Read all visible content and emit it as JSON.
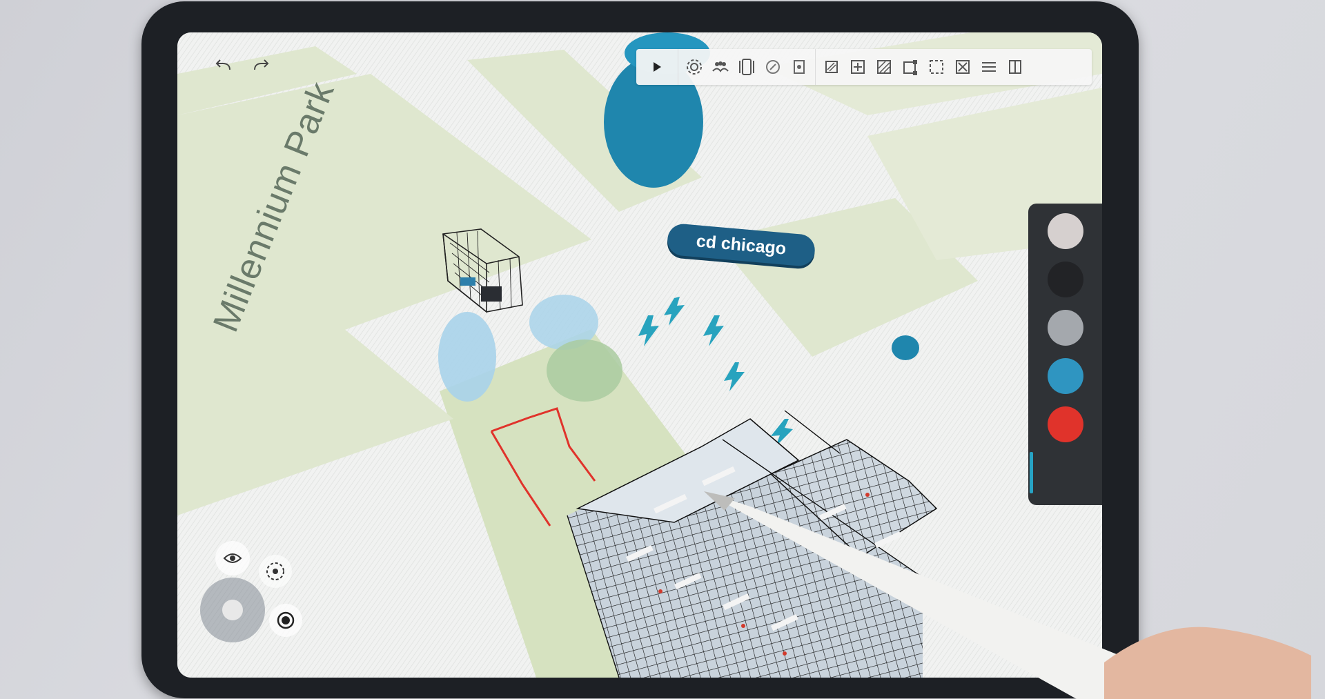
{
  "map": {
    "park_label": "Millennium Park",
    "location_tag": "cd chicago"
  },
  "history": {
    "undo_icon": "undo-arrow-icon",
    "redo_icon": "redo-arrow-icon"
  },
  "toolbar": {
    "groups": [
      [
        "play-icon"
      ],
      [
        "gear-icon",
        "people-icon",
        "phone-frame-icon",
        "compass-icon",
        "layers-target-icon"
      ],
      [
        "hatch-small-icon",
        "add-box-icon",
        "hatch-box-icon",
        "corner-handle-icon",
        "dashed-select-icon",
        "cross-box-icon",
        "split-horizontal-icon",
        "split-vertical-icon"
      ]
    ]
  },
  "palette": {
    "colors": [
      "#d6d0cf",
      "#222326",
      "#a4a8ad",
      "#2f95c1",
      "#e0332b"
    ],
    "selected_index": 3
  },
  "controls": {
    "icons": [
      "eye-icon",
      "orbit-icon",
      "joystick-icon",
      "target-icon"
    ]
  }
}
